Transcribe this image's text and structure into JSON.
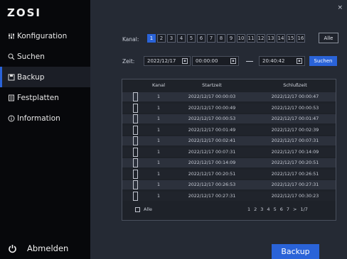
{
  "app": {
    "logo": "ZOSI",
    "close_label": "×"
  },
  "sidebar": {
    "items": [
      {
        "label": "Konfiguration",
        "icon": "settings-icon"
      },
      {
        "label": "Suchen",
        "icon": "search-icon"
      },
      {
        "label": "Backup",
        "icon": "backup-icon"
      },
      {
        "label": "Festplatten",
        "icon": "harddisk-icon"
      },
      {
        "label": "Information",
        "icon": "info-icon"
      }
    ],
    "active_index": 2,
    "logout_label": "Abmelden"
  },
  "filters": {
    "kanal_label": "Kanal:",
    "channels": [
      "1",
      "2",
      "3",
      "4",
      "5",
      "6",
      "7",
      "8",
      "9",
      "10",
      "11",
      "12",
      "13",
      "14",
      "15",
      "16"
    ],
    "active_channel": "1",
    "alle_label": "Alle",
    "zeit_label": "Zeit:",
    "start_date": "2022/12/17",
    "start_time": "00:00:00",
    "end_time": "20:40:42",
    "suchen_label": "Suchen"
  },
  "table": {
    "headers": {
      "kanal": "Kanal",
      "start": "Startzeit",
      "end": "Schlußzeit"
    },
    "rows": [
      {
        "kanal": "1",
        "start": "2022/12/17 00:00:03",
        "end": "2022/12/17 00:00:47"
      },
      {
        "kanal": "1",
        "start": "2022/12/17 00:00:49",
        "end": "2022/12/17 00:00:53"
      },
      {
        "kanal": "1",
        "start": "2022/12/17 00:00:53",
        "end": "2022/12/17 00:01:47"
      },
      {
        "kanal": "1",
        "start": "2022/12/17 00:01:49",
        "end": "2022/12/17 00:02:39"
      },
      {
        "kanal": "1",
        "start": "2022/12/17 00:02:41",
        "end": "2022/12/17 00:07:31"
      },
      {
        "kanal": "1",
        "start": "2022/12/17 00:07:31",
        "end": "2022/12/17 00:14:09"
      },
      {
        "kanal": "1",
        "start": "2022/12/17 00:14:09",
        "end": "2022/12/17 00:20:51"
      },
      {
        "kanal": "1",
        "start": "2022/12/17 00:20:51",
        "end": "2022/12/17 00:26:51"
      },
      {
        "kanal": "1",
        "start": "2022/12/17 00:26:53",
        "end": "2022/12/17 00:27:31"
      },
      {
        "kanal": "1",
        "start": "2022/12/17 00:27:31",
        "end": "2022/12/17 00:30:23"
      }
    ],
    "select_all_label": "Alle",
    "pages": [
      "1",
      "2",
      "3",
      "4",
      "5",
      "6",
      "7",
      ">",
      "1/7"
    ]
  },
  "actions": {
    "backup_label": "Backup"
  },
  "colors": {
    "accent": "#2a63d8",
    "panel": "#252a34",
    "sidebar": "#07080b"
  }
}
